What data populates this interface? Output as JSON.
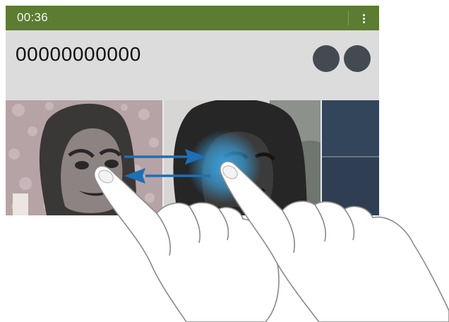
{
  "status_bar": {
    "call_duration": "00:36",
    "menu_icon": "more-vertical-icon",
    "background_color": "#5c7c31"
  },
  "call": {
    "phone_number": "00000000000",
    "participants": [
      {
        "icon": "avatar-icon"
      },
      {
        "icon": "avatar-icon"
      }
    ]
  },
  "video_tiles": [
    {
      "icon": "participant-video-icon"
    },
    {
      "icon": "participant-video-icon"
    },
    {
      "icon": "participant-video-icon"
    }
  ],
  "gesture": {
    "icon": "two-finger-swipe-icon",
    "arrow_color": "#1e6fb5",
    "touch_glow_color": "#39a9ea"
  }
}
